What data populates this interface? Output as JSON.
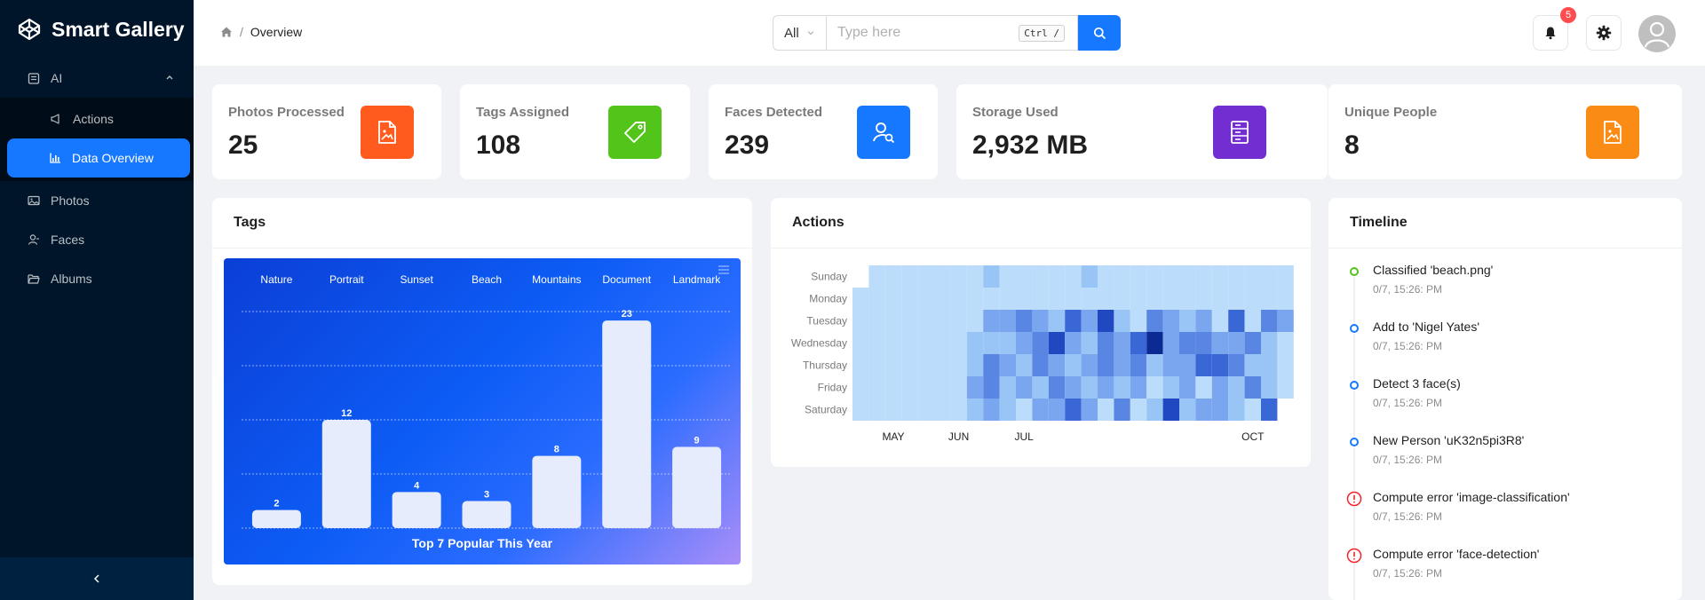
{
  "app": {
    "title": "Smart Gallery"
  },
  "sidebar": {
    "items": [
      {
        "label": "AI",
        "expanded": true,
        "children": [
          {
            "label": "Actions"
          },
          {
            "label": "Data Overview",
            "active": true
          }
        ]
      },
      {
        "label": "Photos"
      },
      {
        "label": "Faces"
      },
      {
        "label": "Albums"
      }
    ],
    "collapse_icon": "chevron-left-icon"
  },
  "header": {
    "breadcrumb": {
      "current": "Overview"
    },
    "search": {
      "scope": "All",
      "placeholder": "Type here",
      "shortcut": "Ctrl /"
    },
    "notifications": {
      "count": "5"
    }
  },
  "stats": [
    {
      "title": "Photos Processed",
      "value": "25",
      "color": "#ff5b1f",
      "icon": "file-image-icon"
    },
    {
      "title": "Tags Assigned",
      "value": "108",
      "color": "#52c41a",
      "icon": "tag-icon"
    },
    {
      "title": "Faces Detected",
      "value": "239",
      "color": "#1677ff",
      "icon": "face-search-icon"
    },
    {
      "title": "Storage Used",
      "value": "2,932 MB",
      "color": "#722ed1",
      "icon": "database-icon"
    },
    {
      "title": "Unique People",
      "value": "8",
      "color": "#fa8c16",
      "icon": "file-image-icon"
    }
  ],
  "panels": {
    "tags": {
      "title": "Tags"
    },
    "actions": {
      "title": "Actions"
    },
    "timeline": {
      "title": "Timeline"
    }
  },
  "chart_data": [
    {
      "type": "bar",
      "title": "Top 7 Popular This Year",
      "categories": [
        "Nature",
        "Portrait",
        "Sunset",
        "Beach",
        "Mountains",
        "Document",
        "Landmark"
      ],
      "values": [
        2,
        12,
        4,
        3,
        8,
        23,
        9
      ],
      "ylim": [
        0,
        24
      ],
      "grid": true,
      "colors": {
        "background_start": "#0b3fd6",
        "background_end": "#a98ef8",
        "bar": "#e6ecfb"
      }
    },
    {
      "type": "heatmap",
      "y_categories": [
        "Sunday",
        "Monday",
        "Tuesday",
        "Wednesday",
        "Thursday",
        "Friday",
        "Saturday"
      ],
      "x_tick_labels": [
        "MAY",
        "JUN",
        "JUL",
        "OCT"
      ],
      "x_tick_weeks": [
        2,
        6,
        10,
        24
      ],
      "weeks": 27,
      "colors": [
        "#bcdcfb",
        "#99c4f6",
        "#7aa6ef",
        "#5a86e3",
        "#3a67d6",
        "#1f48c1",
        "#0b2a94"
      ],
      "values": [
        [
          -1,
          0,
          0,
          0,
          0,
          0,
          0,
          0,
          1,
          0,
          0,
          0,
          0,
          0,
          1,
          0,
          0,
          0,
          0,
          0,
          0,
          0,
          0,
          0,
          0,
          0,
          0
        ],
        [
          0,
          0,
          0,
          0,
          0,
          0,
          0,
          0,
          0,
          0,
          0,
          0,
          0,
          0,
          0,
          0,
          0,
          0,
          0,
          0,
          0,
          0,
          0,
          0,
          0,
          0,
          0
        ],
        [
          0,
          0,
          0,
          0,
          0,
          0,
          0,
          0,
          2,
          2,
          3,
          2,
          1,
          4,
          2,
          5,
          1,
          0,
          3,
          2,
          1,
          2,
          0,
          4,
          0,
          3,
          2
        ],
        [
          0,
          0,
          0,
          0,
          0,
          0,
          0,
          1,
          1,
          1,
          2,
          3,
          5,
          2,
          1,
          3,
          2,
          4,
          6,
          2,
          3,
          3,
          2,
          2,
          3,
          1,
          0
        ],
        [
          0,
          0,
          0,
          0,
          0,
          0,
          0,
          1,
          3,
          2,
          1,
          3,
          2,
          1,
          2,
          3,
          2,
          3,
          1,
          2,
          2,
          4,
          4,
          3,
          1,
          1,
          0
        ],
        [
          0,
          0,
          0,
          0,
          0,
          0,
          0,
          2,
          3,
          1,
          2,
          1,
          3,
          2,
          1,
          2,
          1,
          2,
          0,
          1,
          2,
          0,
          2,
          1,
          3,
          1,
          0
        ],
        [
          0,
          0,
          0,
          0,
          0,
          0,
          0,
          1,
          2,
          1,
          0,
          2,
          2,
          4,
          2,
          0,
          3,
          0,
          1,
          5,
          1,
          2,
          2,
          1,
          0,
          4,
          -1
        ]
      ]
    }
  ],
  "timeline": [
    {
      "text": "Classified 'beach.png'",
      "time": "0/7, 15:26: PM",
      "status": "success",
      "color": "#52c41a"
    },
    {
      "text": "Add to 'Nigel Yates'",
      "time": "0/7, 15:26: PM",
      "status": "info",
      "color": "#1677ff"
    },
    {
      "text": "Detect 3 face(s)",
      "time": "0/7, 15:26: PM",
      "status": "info",
      "color": "#1677ff"
    },
    {
      "text": "New Person 'uK32n5pi3R8'",
      "time": "0/7, 15:26: PM",
      "status": "info",
      "color": "#1677ff"
    },
    {
      "text": "Compute error 'image-classification'",
      "time": "0/7, 15:26: PM",
      "status": "error",
      "color": "#f5222d"
    },
    {
      "text": "Compute error 'face-detection'",
      "time": "0/7, 15:26: PM",
      "status": "error",
      "color": "#f5222d"
    }
  ]
}
